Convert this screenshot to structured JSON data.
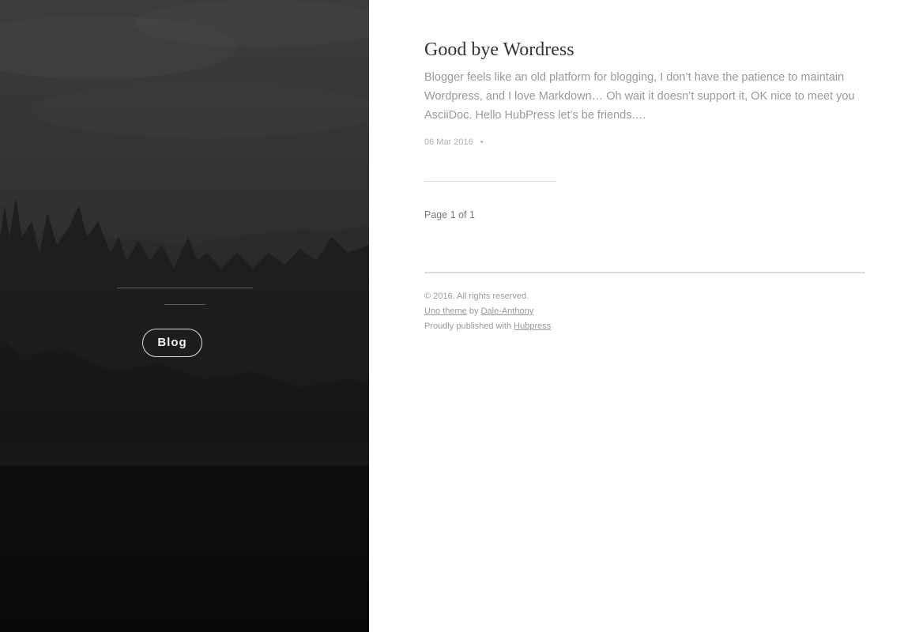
{
  "cover": {
    "blog_button_label": "Blog"
  },
  "post": {
    "title": "Good bye Wordress",
    "excerpt": "Blogger feels like an old platform for blogging, I don’t have the patience to maintain Wordpress, and I love Markdown… Oh wait it doesn’t support it, OK nice to meet you AsciiDoc. Hello HubPress let’s be friends.…",
    "date": "06 Mar 2016",
    "meta_separator": "•"
  },
  "pagination": {
    "text": "Page 1 of 1"
  },
  "footer": {
    "copyright": "© 2016. All rights reserved.",
    "theme_link": "Uno theme",
    "by_text": "by",
    "author_link": "Dale-Anthony",
    "published_text": "Proudly published with",
    "platform_link": "Hubpress"
  }
}
